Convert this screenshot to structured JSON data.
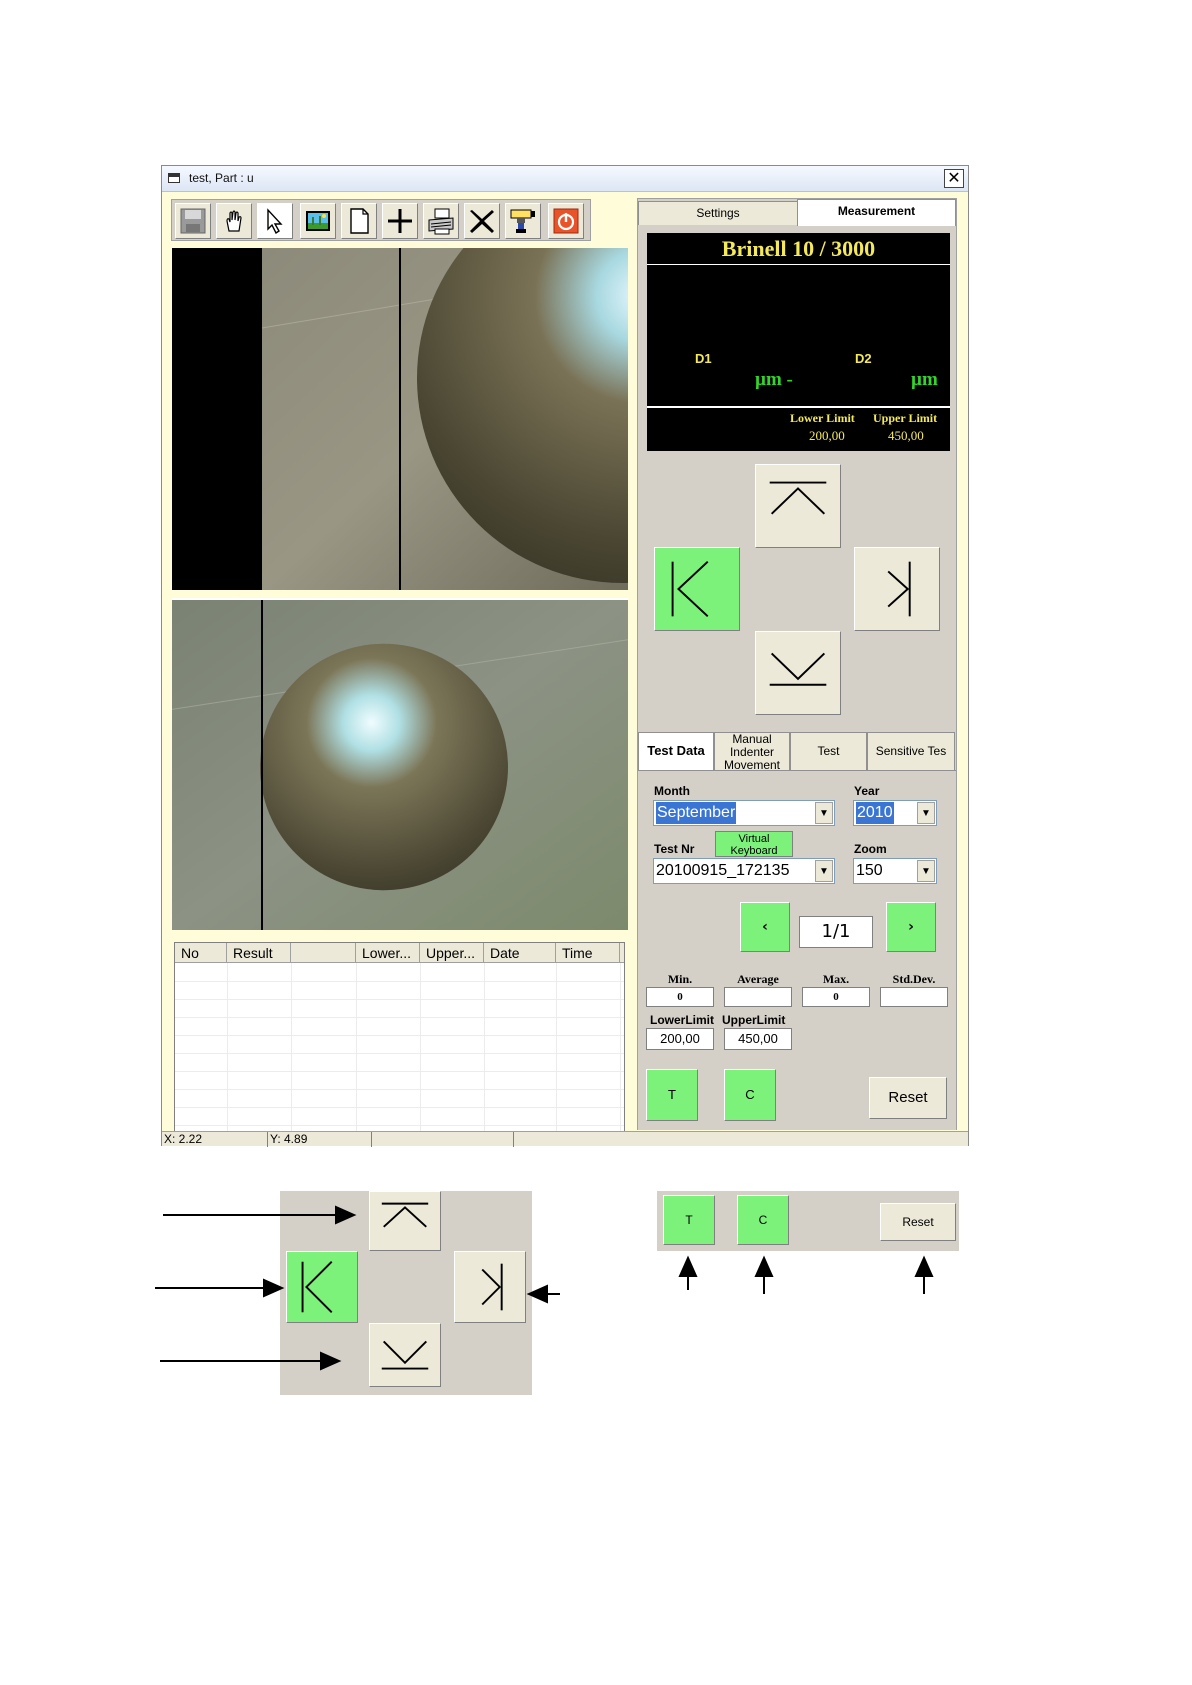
{
  "window": {
    "title": "test, Part : u",
    "close_glyph": "✕"
  },
  "toolbar": {
    "buttons": [
      "save-icon",
      "hand-icon",
      "pointer-icon",
      "image-icon",
      "new-document-icon",
      "plus-icon",
      "printer-icon",
      "delete-icon",
      "camera-icon",
      "power-icon"
    ]
  },
  "table": {
    "columns": [
      "No",
      "Result",
      "",
      "Lower...",
      "Upper...",
      "Date",
      "Time"
    ],
    "rows": []
  },
  "statusbar": {
    "x": "X: 2.22",
    "y": "Y: 4.89",
    "cell3": "",
    "cell4": ""
  },
  "tabs": {
    "settings": "Settings",
    "measurement": "Measurement"
  },
  "display": {
    "title": "Brinell 10 / 3000",
    "d1_label": "D1",
    "d2_label": "D2",
    "d1_unit": "µm -",
    "d2_unit": "µm",
    "lower_limit_label": "Lower Limit",
    "upper_limit_label": "Upper Limit",
    "lower_limit_value": "200,00",
    "upper_limit_value": "450,00"
  },
  "arrows": {
    "up": "arrow-up-icon",
    "left": "arrow-left-icon",
    "right": "arrow-right-icon",
    "down": "arrow-down-icon"
  },
  "subtabs": {
    "test_data": "Test Data",
    "manual_l1": "Manual",
    "manual_l2": "Indenter",
    "manual_l3": "Movement",
    "test": "Test",
    "sensitive": "Sensitive Tes"
  },
  "form": {
    "month_label": "Month",
    "month_value": "September",
    "year_label": "Year",
    "year_value": "2010",
    "testnr_label": "Test Nr",
    "testnr_value": "20100915_172135",
    "virtual_kb_l1": "Virtual",
    "virtual_kb_l2": "Keyboard",
    "zoom_label": "Zoom",
    "zoom_value": "150",
    "prev_label": "‹",
    "next_label": "›",
    "page": "1/1"
  },
  "stats": {
    "min_label": "Min.",
    "avg_label": "Average",
    "max_label": "Max.",
    "std_label": "Std.Dev.",
    "min_value": "0",
    "avg_value": "",
    "max_value": "0",
    "std_value": ""
  },
  "limits": {
    "lower_label": "LowerLimit",
    "upper_label": "UpperLimit",
    "lower_value": "200,00",
    "upper_value": "450,00"
  },
  "actions": {
    "t_label": "T",
    "c_label": "C",
    "reset_label": "Reset"
  },
  "colors": {
    "accent_green": "#7cf27a",
    "display_yellow": "#f4e95b",
    "display_green": "#32d62b",
    "panel_gray": "#d4d0c8"
  }
}
